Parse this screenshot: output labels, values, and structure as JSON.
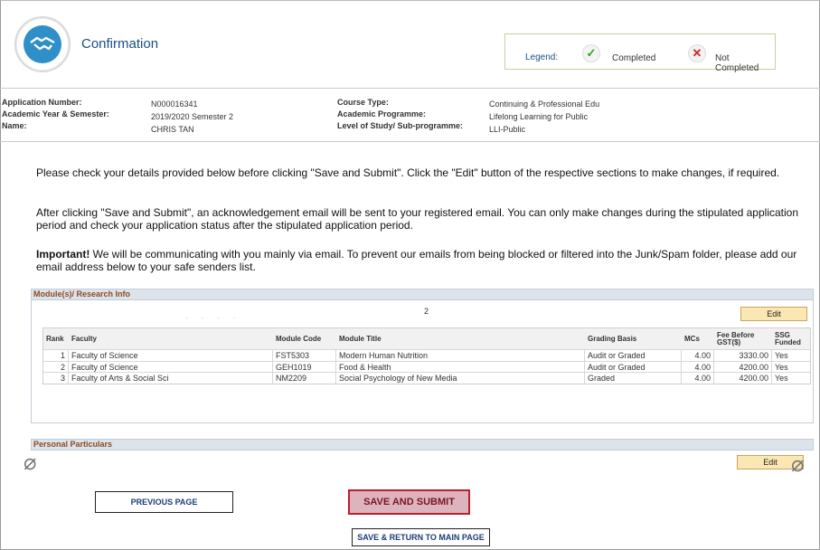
{
  "header": {
    "title": "Confirmation",
    "legend": {
      "label": "Legend:",
      "completed": "Completed",
      "not_completed": "Not Completed"
    }
  },
  "application": {
    "left": [
      {
        "label": "Application Number:",
        "value": "N000016341"
      },
      {
        "label": "Academic Year & Semester:",
        "value": "2019/2020 Semester 2"
      },
      {
        "label": "Name:",
        "value": "CHRIS TAN"
      }
    ],
    "right": [
      {
        "label": "Course Type:",
        "value": "Continuing & Professional Edu"
      },
      {
        "label": "Academic Programme:",
        "value": "Lifelong Learning for Public"
      },
      {
        "label": "Level of Study/ Sub-programme:",
        "value": "LLI-Public"
      }
    ]
  },
  "instructions": {
    "p1": "Please check your details provided below before clicking \"Save and Submit\". Click the \"Edit\" button of the respective sections to make changes, if required.",
    "p2": "After clicking \"Save and Submit\", an acknowledgement email will be sent to your registered email. You can only make changes during the stipulated application period and check your application status after the stipulated application period.",
    "p3_bold": "Important!",
    "p3": " We will be communicating with you mainly via email. To prevent our emails from being blocked or filtered into the Junk/Spam folder, please add our email address below to your safe senders list."
  },
  "modules": {
    "section_title": "Module(s)/ Research Info",
    "count": "2",
    "edit_label": "Edit",
    "columns": [
      "Rank",
      "Faculty",
      "Module Code",
      "Module Title",
      "Grading Basis",
      "MCs",
      "Fee Before GST($)",
      "SSG Funded"
    ],
    "rows": [
      {
        "rank": "1",
        "faculty": "Faculty of Science",
        "code": "FST5303",
        "title": "Modern Human Nutrition",
        "grading": "Audit or Graded",
        "mcs": "4.00",
        "fee": "3330.00",
        "ssg": "Yes"
      },
      {
        "rank": "2",
        "faculty": "Faculty of Science",
        "code": "GEH1019",
        "title": "Food & Health",
        "grading": "Audit or Graded",
        "mcs": "4.00",
        "fee": "4200.00",
        "ssg": "Yes"
      },
      {
        "rank": "3",
        "faculty": "Faculty of Arts & Social Sci",
        "code": "NM2209",
        "title": "Social Psychology of New Media",
        "grading": "Graded",
        "mcs": "4.00",
        "fee": "4200.00",
        "ssg": "Yes"
      }
    ]
  },
  "personal": {
    "section_title": "Personal Particulars",
    "edit_label": "Edit"
  },
  "actions": {
    "previous": "PREVIOUS PAGE",
    "submit": "SAVE AND SUBMIT",
    "save_return": "SAVE & RETURN TO MAIN PAGE"
  }
}
